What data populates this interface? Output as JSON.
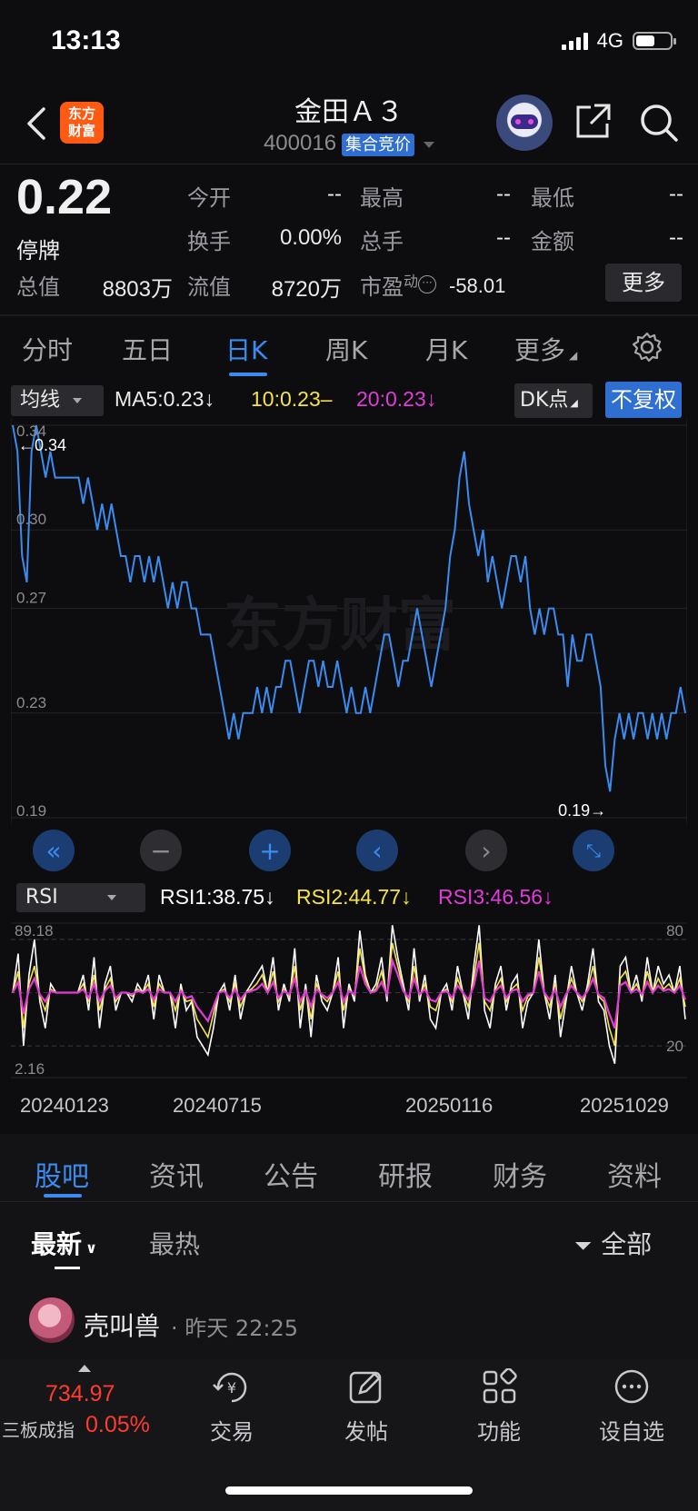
{
  "status_bar": {
    "time": "13:13",
    "network": "4G",
    "battery_level": 0.55
  },
  "header": {
    "logo_text": "东方\n财富",
    "stock_name": "金田Ａ３",
    "stock_code": "400016",
    "auction_badge": "集合竞价"
  },
  "quote": {
    "price": "0.22",
    "status": "停牌",
    "fields": {
      "open_label": "今开",
      "open_value": "--",
      "high_label": "最高",
      "high_value": "--",
      "low_label": "最低",
      "low_value": "--",
      "turnover_label": "换手",
      "turnover_value": "0.00%",
      "volume_label": "总手",
      "volume_value": "--",
      "amount_label": "金额",
      "amount_value": "--",
      "mktcap_label": "总值",
      "mktcap_value": "8803万",
      "float_label": "流值",
      "float_value": "8720万",
      "pe_label": "市盈",
      "pe_sup": "动",
      "pe_value": "-58.01"
    },
    "more_label": "更多"
  },
  "period_tabs": [
    "分时",
    "五日",
    "日K",
    "周K",
    "月K",
    "更多"
  ],
  "active_period": "日K",
  "indicator_row": {
    "ma_select": "均线",
    "ma5": "MA5:0.23↓",
    "ma10": "10:0.23–",
    "ma20": "20:0.23↓",
    "dk_button": "DK点",
    "fq_button": "不复权"
  },
  "kline": {
    "watermark": "东方财富",
    "y_labels": [
      "0.34",
      "0.30",
      "0.27",
      "0.23",
      "0.19"
    ],
    "max_marker": "←0.34",
    "min_marker": "0.19→",
    "ylim": [
      0.19,
      0.34
    ]
  },
  "rsi_row": {
    "select": "RSI",
    "rsi1": "RSI1:38.75↓",
    "rsi2": "RSI2:44.77↓",
    "rsi3": "RSI3:46.56↓",
    "left_top": "89.18",
    "left_bottom": "2.16",
    "right_top": "80",
    "right_bottom": "20"
  },
  "dates": [
    "20240123",
    "20240715",
    "20250116",
    "20251029"
  ],
  "content_tabs": [
    "股吧",
    "资讯",
    "公告",
    "研报",
    "财务",
    "资料"
  ],
  "active_content_tab": "股吧",
  "sort": {
    "newest": "最新",
    "hottest": "最热",
    "filter_all": "全部"
  },
  "post": {
    "username": "壳叫兽",
    "time": "· 昨天 22:25"
  },
  "index_ticker": {
    "name": "三板成指",
    "value": "734.97",
    "change": "0.05%"
  },
  "nav": [
    "交易",
    "发帖",
    "功能",
    "设自选"
  ],
  "colors": {
    "accent": "#3b8cf0",
    "up": "#ff3b30",
    "ma10": "#f4e34a",
    "ma20": "#e23bd9",
    "rsi1": "#ffffff",
    "rsi2": "#f4e34a",
    "rsi3": "#e23bd9"
  },
  "chart_data": [
    {
      "type": "line",
      "title": "",
      "ylim": [
        0.19,
        0.34
      ],
      "series": [
        {
          "values": [
            0.34,
            0.33,
            0.29,
            0.28,
            0.33,
            0.34,
            0.33,
            0.32,
            0.33,
            0.32,
            0.32,
            0.32,
            0.32,
            0.32,
            0.32,
            0.31,
            0.32,
            0.31,
            0.3,
            0.31,
            0.3,
            0.31,
            0.3,
            0.29,
            0.29,
            0.28,
            0.29,
            0.29,
            0.28,
            0.29,
            0.28,
            0.29,
            0.28,
            0.27,
            0.28,
            0.27,
            0.28,
            0.28,
            0.27,
            0.27,
            0.26,
            0.26,
            0.26,
            0.25,
            0.24,
            0.23,
            0.22,
            0.23,
            0.22,
            0.23,
            0.23,
            0.23,
            0.24,
            0.23,
            0.24,
            0.23,
            0.24,
            0.24,
            0.25,
            0.25,
            0.24,
            0.23,
            0.24,
            0.25,
            0.25,
            0.24,
            0.25,
            0.24,
            0.24,
            0.25,
            0.24,
            0.23,
            0.24,
            0.23,
            0.23,
            0.24,
            0.23,
            0.24,
            0.25,
            0.26,
            0.26,
            0.25,
            0.24,
            0.25,
            0.25,
            0.26,
            0.27,
            0.26,
            0.25,
            0.24,
            0.25,
            0.26,
            0.27,
            0.29,
            0.3,
            0.32,
            0.33,
            0.31,
            0.3,
            0.29,
            0.3,
            0.28,
            0.29,
            0.28,
            0.27,
            0.28,
            0.29,
            0.29,
            0.28,
            0.29,
            0.27,
            0.26,
            0.27,
            0.26,
            0.27,
            0.27,
            0.26,
            0.26,
            0.24,
            0.26,
            0.25,
            0.25,
            0.26,
            0.26,
            0.25,
            0.24,
            0.21,
            0.2,
            0.22,
            0.23,
            0.22,
            0.23,
            0.22,
            0.23,
            0.23,
            0.22,
            0.23,
            0.22,
            0.23,
            0.22,
            0.23,
            0.23,
            0.24,
            0.23
          ]
        }
      ]
    },
    {
      "type": "line",
      "title": "",
      "ylim": [
        2.16,
        89.18
      ],
      "series": [
        {
          "name": "RSI1",
          "values": [
            50,
            72,
            20,
            60,
            80,
            45,
            30,
            55,
            50,
            50,
            50,
            50,
            50,
            60,
            40,
            70,
            30,
            55,
            65,
            40,
            50,
            50,
            45,
            55,
            50,
            60,
            35,
            60,
            50,
            50,
            30,
            55,
            40,
            45,
            25,
            20,
            15,
            30,
            50,
            55,
            40,
            60,
            35,
            50,
            55,
            60,
            65,
            50,
            70,
            40,
            55,
            45,
            75,
            30,
            55,
            25,
            60,
            45,
            40,
            50,
            70,
            30,
            55,
            45,
            85,
            60,
            50,
            55,
            70,
            45,
            88,
            70,
            55,
            40,
            75,
            45,
            60,
            35,
            30,
            50,
            55,
            40,
            65,
            50,
            35,
            65,
            88,
            40,
            30,
            55,
            65,
            40,
            55,
            60,
            30,
            45,
            50,
            80,
            50,
            35,
            60,
            25,
            45,
            65,
            50,
            40,
            55,
            75,
            45,
            40,
            20,
            10,
            65,
            70,
            50,
            60,
            45,
            70,
            50,
            65,
            55,
            60,
            50,
            65,
            35
          ]
        },
        {
          "name": "RSI2",
          "values": [
            50,
            62,
            30,
            55,
            65,
            48,
            40,
            52,
            50,
            50,
            50,
            50,
            50,
            55,
            45,
            60,
            40,
            52,
            58,
            45,
            50,
            50,
            48,
            52,
            50,
            55,
            42,
            55,
            50,
            50,
            40,
            52,
            45,
            46,
            35,
            30,
            25,
            38,
            50,
            52,
            45,
            55,
            42,
            50,
            52,
            55,
            60,
            50,
            62,
            45,
            52,
            48,
            65,
            40,
            52,
            35,
            55,
            48,
            45,
            50,
            62,
            40,
            52,
            48,
            75,
            58,
            50,
            52,
            62,
            48,
            78,
            65,
            52,
            45,
            65,
            48,
            55,
            42,
            40,
            50,
            52,
            45,
            58,
            50,
            42,
            58,
            78,
            45,
            40,
            52,
            58,
            45,
            52,
            55,
            40,
            48,
            50,
            70,
            50,
            42,
            55,
            35,
            48,
            58,
            50,
            45,
            52,
            65,
            48,
            45,
            30,
            20,
            58,
            62,
            50,
            55,
            48,
            62,
            50,
            58,
            52,
            55,
            50,
            58,
            42
          ]
        },
        {
          "name": "RSI3",
          "values": [
            50,
            56,
            38,
            52,
            58,
            49,
            45,
            51,
            50,
            50,
            50,
            50,
            50,
            52,
            47,
            55,
            45,
            51,
            54,
            47,
            50,
            50,
            49,
            51,
            50,
            52,
            46,
            52,
            50,
            50,
            45,
            51,
            47,
            48,
            42,
            38,
            34,
            42,
            50,
            51,
            47,
            52,
            46,
            50,
            51,
            52,
            55,
            50,
            56,
            47,
            51,
            49,
            58,
            45,
            51,
            42,
            52,
            49,
            47,
            50,
            56,
            45,
            51,
            49,
            65,
            55,
            50,
            51,
            56,
            49,
            68,
            60,
            51,
            47,
            58,
            49,
            52,
            46,
            45,
            50,
            51,
            47,
            54,
            50,
            46,
            54,
            68,
            47,
            45,
            51,
            54,
            47,
            51,
            52,
            45,
            49,
            50,
            62,
            50,
            46,
            52,
            42,
            49,
            54,
            50,
            47,
            51,
            58,
            49,
            47,
            38,
            30,
            54,
            56,
            50,
            52,
            49,
            56,
            50,
            54,
            51,
            52,
            50,
            54,
            46
          ]
        }
      ]
    }
  ]
}
